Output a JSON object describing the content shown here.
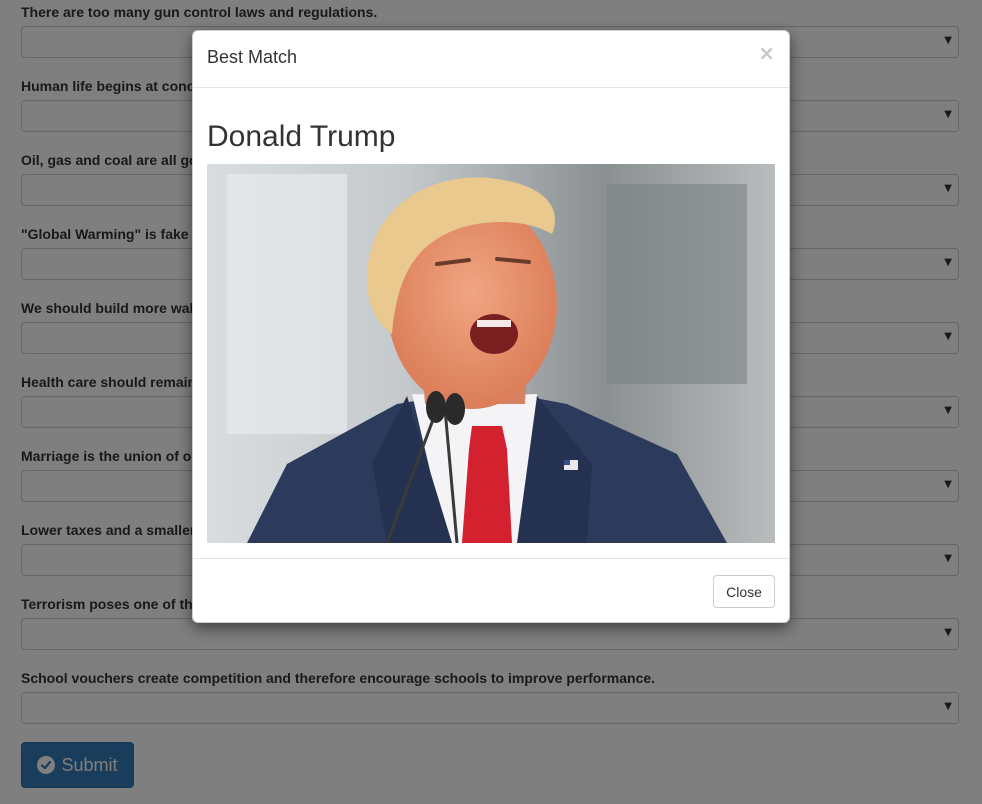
{
  "form": {
    "questions": [
      {
        "label": "There are too many gun control laws and regulations.",
        "value": ""
      },
      {
        "label": "Human life begins at conc",
        "value": ""
      },
      {
        "label": "Oil, gas and coal are all go",
        "value": ""
      },
      {
        "label": "\"Global Warming\" is fake",
        "value": ""
      },
      {
        "label": "We should build more wal",
        "value": ""
      },
      {
        "label": "Health care should remain",
        "value": ""
      },
      {
        "label": "Marriage is the union of o",
        "value": ""
      },
      {
        "label": "Lower taxes and a smaller",
        "value": ""
      },
      {
        "label": "Terrorism poses one of th",
        "value": ""
      },
      {
        "label": "School vouchers create competition and therefore encourage schools to improve performance.",
        "value": ""
      }
    ],
    "submit_label": "Submit"
  },
  "modal": {
    "title": "Best Match",
    "close_symbol": "×",
    "candidate_name": "Donald Trump",
    "close_label": "Close"
  },
  "icons": {
    "submit": "check-circle-icon",
    "dropdown": "caret-down-icon",
    "modal_close": "close-icon"
  },
  "colors": {
    "primary": "#337ab7",
    "backdrop": "rgba(0,0,0,0.5)",
    "tie": "#d3212f",
    "suit": "#2c3a5c"
  }
}
